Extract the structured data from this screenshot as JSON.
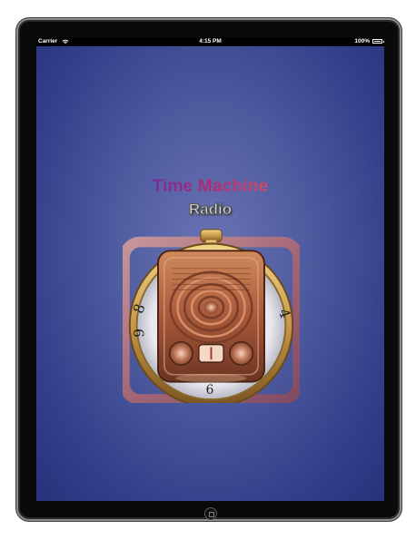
{
  "status_bar": {
    "carrier": "Carrier",
    "time": "4:15 PM",
    "battery": "100%"
  },
  "app": {
    "title": "Time Machine",
    "subtitle": "Radio"
  },
  "colors": {
    "background_center": "#6a74b4",
    "background_edge": "#26327a",
    "title_start": "#2a2f9a",
    "title_end": "#f0a070"
  },
  "icons": [
    "wifi-icon",
    "battery-icon",
    "radio-clock-icon",
    "home-button"
  ]
}
